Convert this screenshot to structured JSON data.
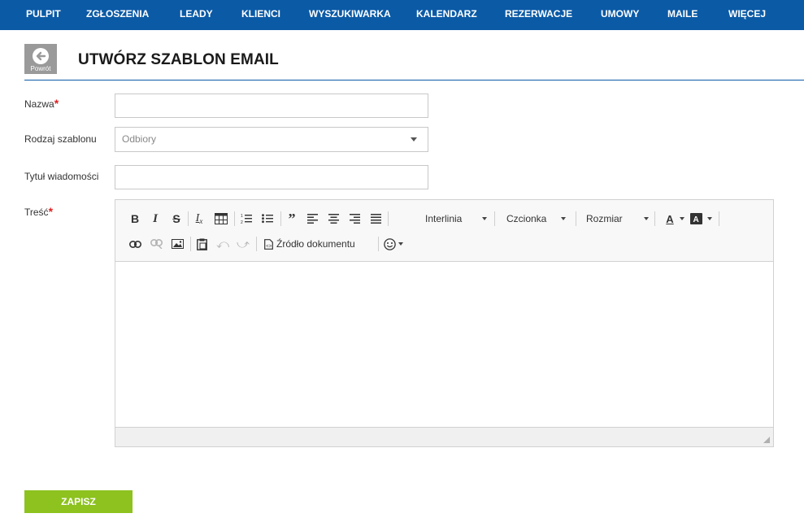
{
  "nav": {
    "items": [
      "PULPIT",
      "ZGŁOSZENIA",
      "LEADY",
      "KLIENCI",
      "WYSZUKIWARKA",
      "KALENDARZ",
      "REZERWACJE",
      "UMOWY",
      "MAILE",
      "WIĘCEJ"
    ]
  },
  "header": {
    "back_label": "Powrót",
    "title": "UTWÓRZ SZABLON EMAIL"
  },
  "form": {
    "name_label": "Nazwa",
    "name_value": "",
    "template_type_label": "Rodzaj szablonu",
    "template_type_value": "Odbiory",
    "subject_label": "Tytuł wiadomości",
    "subject_value": "",
    "body_label": "Treść",
    "required_mark": "*"
  },
  "editor": {
    "line_height_label": "Interlinia",
    "font_label": "Czcionka",
    "size_label": "Rozmiar",
    "source_label": "Źródło dokumentu"
  },
  "actions": {
    "save_label": "ZAPISZ"
  },
  "colors": {
    "nav_bg": "#0b5aa6",
    "accent_required": "#e02020",
    "save_bg": "#8dc21f"
  }
}
